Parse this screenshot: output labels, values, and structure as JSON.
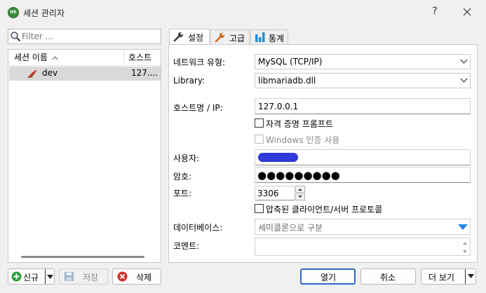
{
  "window": {
    "title": "세션 관리자",
    "logo_text": "HS",
    "help_label": "?"
  },
  "filter": {
    "placeholder": "Filter ..."
  },
  "session_list": {
    "columns": [
      "세션 이름",
      "호스트"
    ],
    "rows": [
      {
        "name": "dev",
        "host": "127...."
      }
    ]
  },
  "tabs": [
    {
      "label": "설정",
      "icon": "wrench-icon",
      "active": true
    },
    {
      "label": "고급",
      "icon": "wrench-orange-icon",
      "active": false
    },
    {
      "label": "통계",
      "icon": "bar-chart-icon",
      "active": false
    }
  ],
  "settings": {
    "network_type_label": "네트워크 유형:",
    "network_type_value": "MySQL (TCP/IP)",
    "library_label": "Library:",
    "library_value": "libmariadb.dll",
    "hostname_label": "호스트명 / IP:",
    "hostname_value": "127.0.0.1",
    "prompt_credentials_label": "자격 증명 프롬프트",
    "windows_auth_label": "Windows 인증 사용",
    "user_label": "사용자:",
    "password_label": "암호:",
    "password_masked": "●●●●●●●●●",
    "port_label": "포트:",
    "port_value": "3306",
    "compressed_label": "압축된 클라이언트/서버 프로토콜",
    "databases_label": "데이터베이스:",
    "databases_placeholder": "세미콜론으로 구분",
    "comment_label": "코멘트:"
  },
  "buttons": {
    "new": "신규",
    "save": "저장",
    "delete": "삭제",
    "open": "열기",
    "cancel": "취소",
    "more": "더 보기"
  },
  "colors": {
    "accent_blue": "#2d69c6",
    "redaction": "#2e3ad8",
    "selected_row": "#d9d9d9",
    "logo_green": "#3d8a3d"
  }
}
